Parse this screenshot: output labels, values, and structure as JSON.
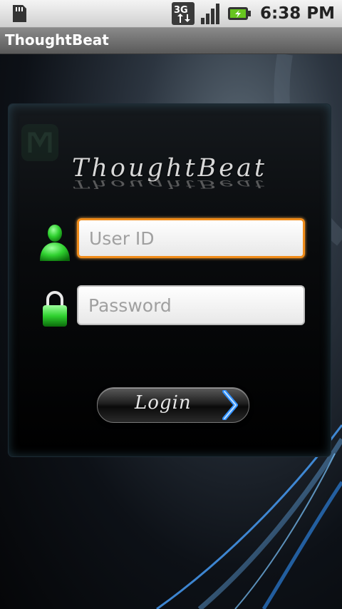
{
  "status_bar": {
    "time": "6:38 PM",
    "network": "3G",
    "icons": [
      "sd-card-icon",
      "3g-icon",
      "signal-icon",
      "battery-charging-icon"
    ]
  },
  "app": {
    "title": "ThoughtBeat"
  },
  "login": {
    "brand": "ThoughtBeat",
    "user_id": {
      "placeholder": "User ID",
      "value": ""
    },
    "password": {
      "placeholder": "Password",
      "value": ""
    },
    "button_label": "Login"
  },
  "colors": {
    "focus": "#f08c1a",
    "icon_green": "#2fd12f",
    "accent_blue": "#2f8fff"
  }
}
